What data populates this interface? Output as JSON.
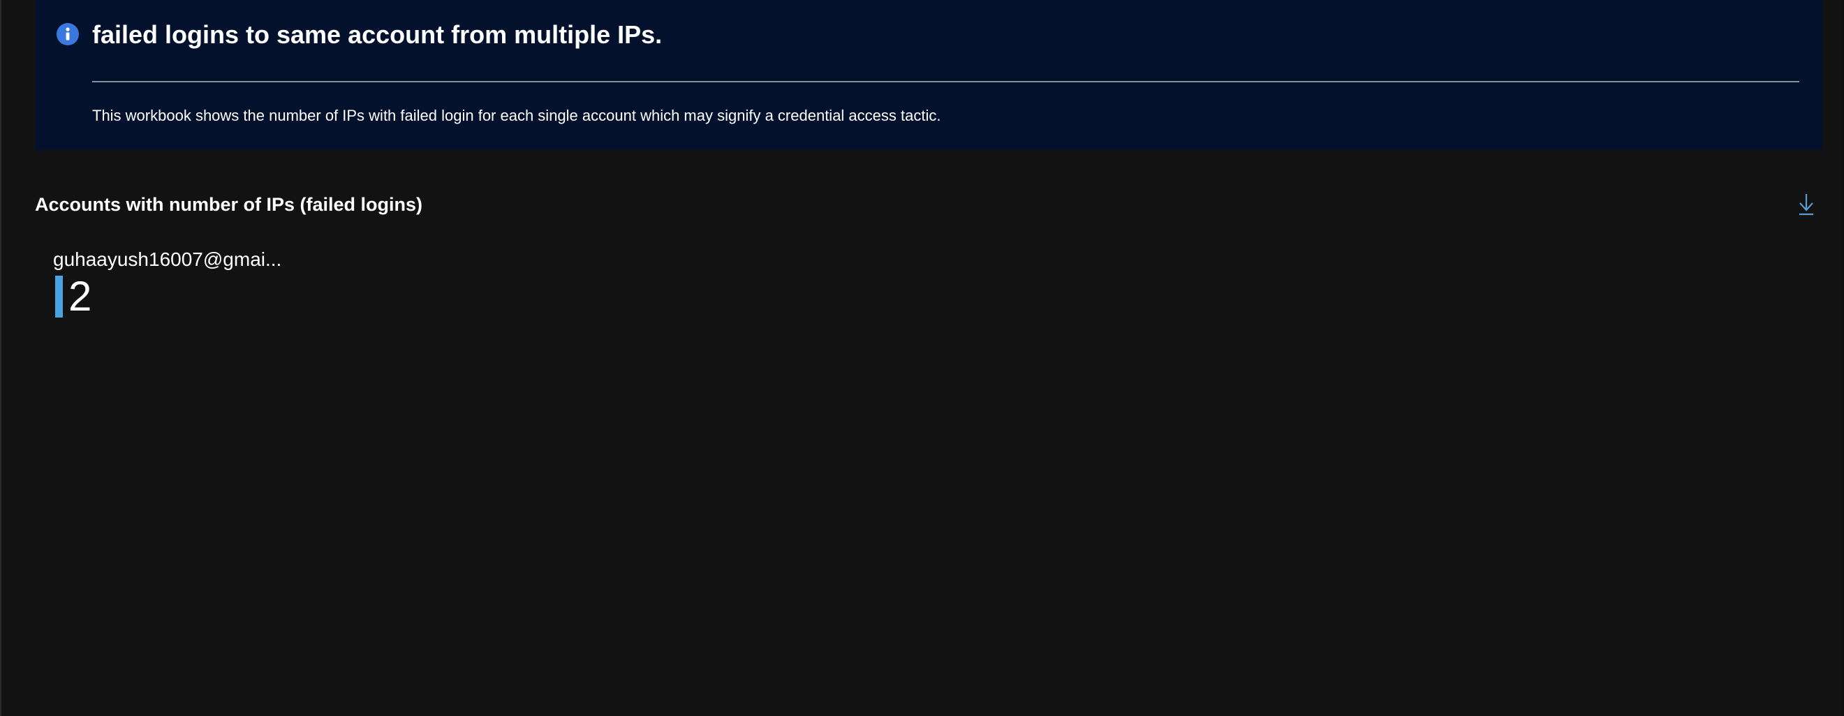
{
  "info": {
    "title": "failed logins to same account from multiple IPs.",
    "description": "This workbook shows the number of IPs with failed login for each single account which may signify a credential access tactic.",
    "icon": "info-icon"
  },
  "tile": {
    "title": "Accounts with number of IPs (failed logins)",
    "download_icon": "download-icon",
    "items": [
      {
        "label": "guhaayush16007@gmai...",
        "value": "2"
      }
    ]
  },
  "colors": {
    "background": "#121212",
    "info_panel": "#03112c",
    "info_icon": "#3a78e0",
    "accent_bar": "#4aa3df",
    "download_icon": "#5b9bd5"
  }
}
